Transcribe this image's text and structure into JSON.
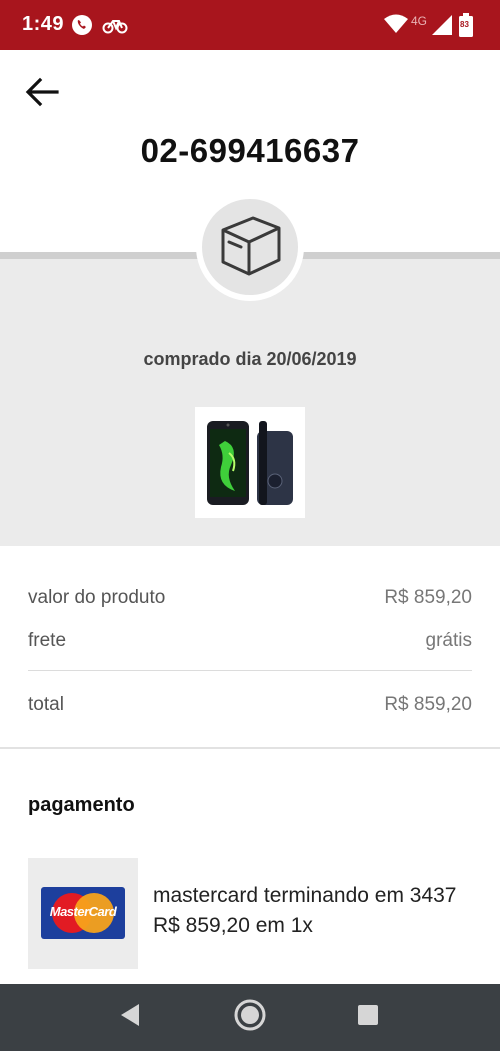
{
  "status_bar": {
    "time": "1:49",
    "network": "4G",
    "battery": "83",
    "icons": [
      "whatsapp-icon",
      "bike-icon",
      "wifi-icon",
      "signal-icon",
      "battery-icon"
    ],
    "background": "#a8151d"
  },
  "header": {
    "back_icon": "arrow-left-icon",
    "order_number": "02-699416637"
  },
  "order": {
    "status_icon": "box-icon",
    "purchase_date": "comprado dia 20/06/2019",
    "product_image": "smartphone-image"
  },
  "summary": {
    "product_value_label": "valor do produto",
    "product_value": "R$ 859,20",
    "shipping_label": "frete",
    "shipping_value": "grátis",
    "total_label": "total",
    "total_value": "R$ 859,20"
  },
  "payment": {
    "title": "pagamento",
    "card_logo_text": "MasterCard",
    "card_line": "mastercard terminando em 3437",
    "amount_line": "R$ 859,20 em 1x"
  },
  "nav": {
    "back_icon": "nav-back-icon",
    "home_icon": "nav-home-icon",
    "recents_icon": "nav-recents-icon"
  }
}
